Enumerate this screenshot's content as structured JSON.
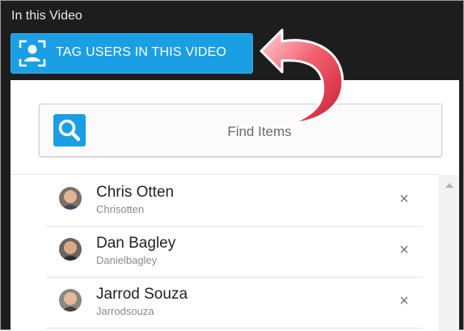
{
  "section": {
    "title": "In this Video"
  },
  "tag_button": {
    "label": "TAG USERS IN THIS VIDEO",
    "icon": "tag-user-icon"
  },
  "search": {
    "placeholder": "Find Items",
    "icon": "search-icon"
  },
  "users": [
    {
      "name": "Chris Otten",
      "handle": "Chrisotten"
    },
    {
      "name": "Dan Bagley",
      "handle": "Danielbagley"
    },
    {
      "name": "Jarrod Souza",
      "handle": "Jarrodsouza"
    }
  ],
  "remove_glyph": "×",
  "colors": {
    "accent": "#1a9fe4",
    "dark_background": "#1d1d1d",
    "callout_arrow": "#d62b3e"
  }
}
